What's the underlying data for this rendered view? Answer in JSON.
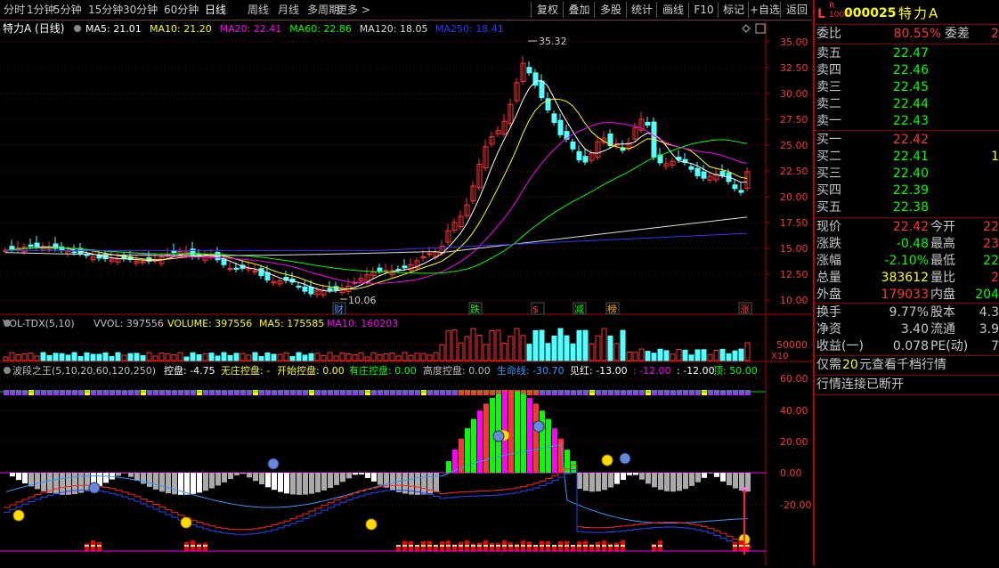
{
  "toolbar": {
    "left_items": [
      "分时",
      "1分钟",
      "5分钟",
      "15分钟",
      "30分钟",
      "60分钟",
      "日线",
      "周线",
      "月线",
      "多周期",
      "更多 >"
    ],
    "active_index": 6,
    "right_items": [
      "复权",
      "叠加",
      "多股",
      "统计",
      "画线",
      "F10",
      "标记",
      "+自选",
      "返回"
    ]
  },
  "main_panel": {
    "stock_label": "特力A (日线)",
    "ma_items": [
      {
        "label": "MA5: 21.01",
        "color": "#ffffff"
      },
      {
        "label": "MA10: 21.20",
        "color": "#ffff00"
      },
      {
        "label": "MA20: 22.41",
        "color": "#ff00ff"
      },
      {
        "label": "MA60: 22.86",
        "color": "#00ff00"
      },
      {
        "label": "MA120: 18.05",
        "color": "#dddddd"
      },
      {
        "label": "MA250: 18.41",
        "color": "#3333ff"
      }
    ],
    "price_labels": [
      "35.00",
      "32.50",
      "30.00",
      "27.50",
      "25.00",
      "22.50",
      "20.00",
      "17.50",
      "15.00",
      "12.50",
      "10.00"
    ],
    "high_label": "35.32",
    "low_label": "10.06",
    "events": [
      {
        "label": "财",
        "color": "#4499ff"
      },
      {
        "label": "跌",
        "color": "#00ff00"
      },
      {
        "label": "$",
        "color": "#ff3333"
      },
      {
        "label": "减",
        "color": "#00ff00"
      },
      {
        "label": "榜",
        "color": "#ffaa00"
      },
      {
        "label": "涨",
        "color": "#ff3333"
      }
    ]
  },
  "volume_panel": {
    "items": [
      {
        "label": "VOL-TDX(5,10)",
        "color": "#c0c0c0"
      },
      {
        "label": "VVOL: 397556",
        "color": "#c0c0c0"
      },
      {
        "label": "VOLUME: 397556",
        "color": "#ffff00"
      },
      {
        "label": "MA5: 175585",
        "color": "#ffff00"
      },
      {
        "label": "MA10: 160203",
        "color": "#ff00ff"
      }
    ],
    "axis_label": "50000",
    "unit_label": "X10"
  },
  "indicator_panel": {
    "items": [
      {
        "label": "波段之王(5,10,20,60,120,250)",
        "color": "#c0c0c0"
      },
      {
        "label": "控盘: -4.75",
        "color": "#ffffff"
      },
      {
        "label": "无庄控盘: -",
        "color": "#ffff00"
      },
      {
        "label": "开始控盘: 0.00",
        "color": "#ffff00"
      },
      {
        "label": "有庄控盘: 0.00",
        "color": "#00ff00"
      },
      {
        "label": "高度控盘: 0.00",
        "color": "#c0c0c0"
      },
      {
        "label": "生命线: -30.70",
        "color": "#3399ff"
      },
      {
        "label": "见红: -13.00",
        "color": "#ffffff"
      },
      {
        "label": ": -12.00",
        "color": "#ff00ff"
      },
      {
        "label": ": -12.00",
        "color": "#ffffff"
      },
      {
        "label": "顶: 50.00",
        "color": "#00ff00"
      }
    ],
    "axis_labels": [
      "60.00",
      "40.00",
      "20.00",
      "0.00",
      "-20.00"
    ]
  },
  "quote": {
    "code": "000025",
    "name": "特力A",
    "wb_label": "委比",
    "wb_value": "80.55%",
    "wc_label": "委差",
    "wc_value": "2",
    "sells": [
      {
        "label": "卖五",
        "price": "22.47"
      },
      {
        "label": "卖四",
        "price": "22.46"
      },
      {
        "label": "卖三",
        "price": "22.45"
      },
      {
        "label": "卖二",
        "price": "22.44"
      },
      {
        "label": "卖一",
        "price": "22.43"
      }
    ],
    "buys": [
      {
        "label": "买一",
        "price": "22.42",
        "vol": ""
      },
      {
        "label": "买二",
        "price": "22.41",
        "vol": "1"
      },
      {
        "label": "买三",
        "price": "22.40",
        "vol": ""
      },
      {
        "label": "买四",
        "price": "22.39",
        "vol": ""
      },
      {
        "label": "买五",
        "price": "22.38",
        "vol": ""
      }
    ],
    "stats": [
      {
        "l1": "现价",
        "v1": "22.42",
        "c1": "#ff3333",
        "l2": "今开",
        "v2": "22",
        "c2": "#ff3333"
      },
      {
        "l1": "涨跌",
        "v1": "-0.48",
        "c1": "#00ff00",
        "l2": "最高",
        "v2": "23",
        "c2": "#ff3333"
      },
      {
        "l1": "涨幅",
        "v1": "-2.10%",
        "c1": "#00ff00",
        "l2": "最低",
        "v2": "22",
        "c2": "#00ff00"
      },
      {
        "l1": "总量",
        "v1": "383612",
        "c1": "#ffff00",
        "l2": "量比",
        "v2": "2",
        "c2": "#ff3333"
      },
      {
        "l1": "外盘",
        "v1": "179033",
        "c1": "#ff3333",
        "l2": "内盘",
        "v2": "204",
        "c2": "#00ff00"
      }
    ],
    "stats2": [
      {
        "l1": "换手",
        "v1": "9.77%",
        "c1": "#c8c8c8",
        "l2": "股本",
        "v2": "4.3",
        "c2": "#c8c8c8"
      },
      {
        "l1": "净资",
        "v1": "3.40",
        "c1": "#c8c8c8",
        "l2": "流通",
        "v2": "3.9",
        "c2": "#c8c8c8"
      },
      {
        "l1": "收益(一)",
        "v1": "0.078",
        "c1": "#c8c8c8",
        "l2": "PE(动)",
        "v2": "7",
        "c2": "#c8c8c8"
      }
    ],
    "promo1_a": "仅需",
    "promo1_b": "20",
    "promo1_c": "元查看千档行情",
    "promo2": "行情连接已断开"
  }
}
